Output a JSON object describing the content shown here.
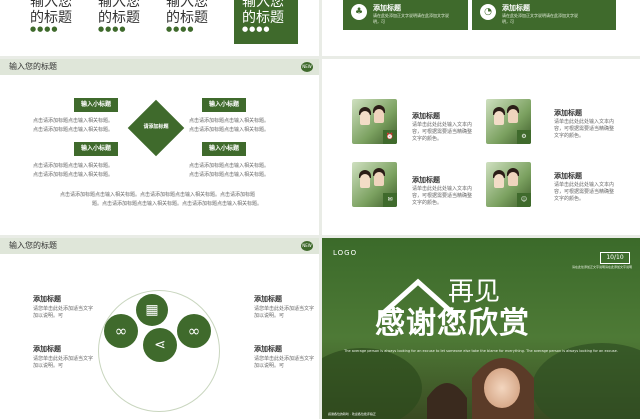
{
  "slide1": {
    "tiles": [
      {
        "title": "输入您的标题",
        "dots": "●●●●"
      },
      {
        "title": "输入您的标题",
        "dots": "●●●●"
      },
      {
        "title": "输入您的标题",
        "dots": "●●●●"
      },
      {
        "title": "输入您的标题",
        "dots": "●●●●"
      }
    ]
  },
  "slide2": {
    "boxes": [
      {
        "title": "添加标题",
        "desc": "请在此处添加正文字说明请在此添加文字说明，可",
        "icon": "tree-icon"
      },
      {
        "title": "添加标题",
        "desc": "请在此处添加正文字说明请在此添加文字说明，可",
        "icon": "pie-chart-icon"
      }
    ]
  },
  "slide3": {
    "header": "输入您的标题",
    "badge": "NEW",
    "center": "请添加标题",
    "pills": [
      "输入小标题",
      "输入小标题",
      "输入小标题",
      "输入小标题"
    ],
    "texts": [
      "点击请添加标题点击输入相关标题。",
      "点击请添加标题点击输入相关标题。",
      "点击请添加标题点击输入相关标题。",
      "点击请添加标题点击输入相关标题。",
      "点击请添加标题点击输入相关标题。",
      "点击请添加标题点击输入相关标题。",
      "点击请添加标题点击输入相关标题。",
      "点击请添加标题点击输入相关标题。"
    ],
    "footer1": "点击请添加标题点击输入相关标题。点击请添加标题点击输入相关标题。点击请添加标题",
    "footer2": "题。点击请添加标题点击输入相关标题。点击请添加标题点击输入相关标题。"
  },
  "slide4": {
    "items": [
      {
        "title": "添加标题",
        "desc": "请单击此处此处输入文本内容，可根据需要适当精确整文字的颜色。",
        "icon": "alarm-icon"
      },
      {
        "title": "添加标题",
        "desc": "请单击此处此处输入文本内容，可根据需要适当精确整文字的颜色。",
        "icon": "gear-icon"
      },
      {
        "title": "添加标题",
        "desc": "请单击此处此处输入文本内容，可根据需要适当精确整文字的颜色。",
        "icon": "mail-icon"
      },
      {
        "title": "添加标题",
        "desc": "请单击此处此处输入文本内容，可根据需要适当精确整文字的颜色。",
        "icon": "user-icon"
      }
    ]
  },
  "slide5": {
    "header": "输入您的标题",
    "badge": "NEW",
    "items": [
      {
        "title": "添加标题",
        "desc": "请您单击此处添加适当文字加以说明。可"
      },
      {
        "title": "添加标题",
        "desc": "请您单击此处添加适当文字加以说明。可"
      },
      {
        "title": "添加标题",
        "desc": "请您单击此处添加适当文字加以说明。可"
      },
      {
        "title": "添加标题",
        "desc": "请您单击此处添加适当文字加以说明。可"
      }
    ]
  },
  "slide6": {
    "logo": "LOGO",
    "page": "10/10",
    "page_sub": "请在此处添加正文字说明请在此添加文字说明",
    "title1": "再见",
    "title2": "感谢您欣赏",
    "subtitle": "The average person is always looking for an excuse to let someone else take the blame for everything. The average person is always looking for an excuse.",
    "footer": "感谢各位的聆听 · 欢迎各位批评指正"
  },
  "colors": {
    "accent": "#3f6a2c",
    "panel": "#dfe6d9"
  }
}
